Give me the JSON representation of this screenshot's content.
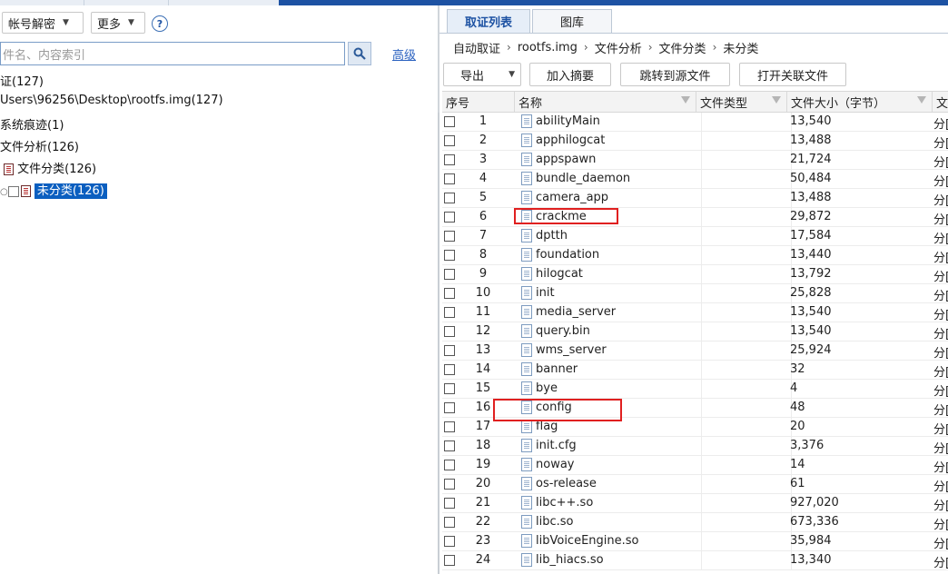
{
  "left": {
    "toolbar": {
      "account_decrypt": "帐号解密",
      "more": "更多",
      "help": "?"
    },
    "search": {
      "placeholder": "件名、内容索引",
      "advanced": "高级"
    },
    "tree": [
      {
        "label": "证(127)"
      },
      {
        "label": "Users\\96256\\Desktop\\rootfs.img(127)"
      },
      {
        "label": "系统痕迹(1)"
      },
      {
        "label": "文件分析(126)"
      },
      {
        "label": "文件分类(126)"
      },
      {
        "label": "未分类(126)"
      }
    ]
  },
  "right": {
    "tabs": [
      "取证列表",
      "图库"
    ],
    "breadcrumb": [
      "自动取证",
      "rootfs.img",
      "文件分析",
      "文件分类",
      "未分类"
    ],
    "toolbar": {
      "export": "导出",
      "add_summary": "加入摘要",
      "jump_source": "跳转到源文件",
      "open_related": "打开关联文件"
    },
    "columns": [
      "序号",
      "名称",
      "文件类型",
      "文件大小（字节）",
      "文"
    ],
    "category_fragment": "分[",
    "rows": [
      {
        "no": "1",
        "name": "abilityMain",
        "size": "13,540"
      },
      {
        "no": "2",
        "name": "apphilogcat",
        "size": "13,488"
      },
      {
        "no": "3",
        "name": "appspawn",
        "size": "21,724"
      },
      {
        "no": "4",
        "name": "bundle_daemon",
        "size": "50,484"
      },
      {
        "no": "5",
        "name": "camera_app",
        "size": "13,488"
      },
      {
        "no": "6",
        "name": "crackme",
        "size": "29,872"
      },
      {
        "no": "7",
        "name": "dptth",
        "size": "17,584"
      },
      {
        "no": "8",
        "name": "foundation",
        "size": "13,440"
      },
      {
        "no": "9",
        "name": "hilogcat",
        "size": "13,792"
      },
      {
        "no": "10",
        "name": "init",
        "size": "25,828"
      },
      {
        "no": "11",
        "name": "media_server",
        "size": "13,540"
      },
      {
        "no": "12",
        "name": "query.bin",
        "size": "13,540"
      },
      {
        "no": "13",
        "name": "wms_server",
        "size": "25,924"
      },
      {
        "no": "14",
        "name": "banner",
        "size": "32"
      },
      {
        "no": "15",
        "name": "bye",
        "size": "4"
      },
      {
        "no": "16",
        "name": "config",
        "size": "48"
      },
      {
        "no": "17",
        "name": "flag",
        "size": "20"
      },
      {
        "no": "18",
        "name": "init.cfg",
        "size": "3,376"
      },
      {
        "no": "19",
        "name": "noway",
        "size": "14"
      },
      {
        "no": "20",
        "name": "os-release",
        "size": "61"
      },
      {
        "no": "21",
        "name": "libc++.so",
        "size": "927,020"
      },
      {
        "no": "22",
        "name": "libc.so",
        "size": "673,336"
      },
      {
        "no": "23",
        "name": "libVoiceEngine.so",
        "size": "35,984"
      },
      {
        "no": "24",
        "name": "lib_hiacs.so",
        "size": "13,340"
      }
    ],
    "highlighted_rows": [
      "crackme",
      "config"
    ]
  },
  "colors": {
    "accent": "#1d52a3",
    "selection": "#0b5fc0",
    "highlight_box": "#e02020"
  }
}
